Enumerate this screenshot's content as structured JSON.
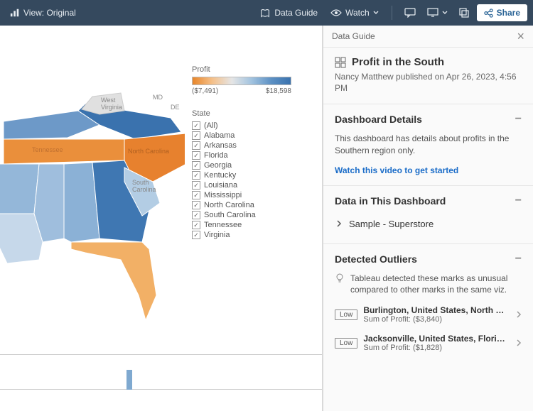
{
  "toolbar": {
    "view_label": "View: Original",
    "data_guide_label": "Data Guide",
    "watch_label": "Watch",
    "share_label": "Share"
  },
  "legend": {
    "title": "Profit",
    "min": "($7,491)",
    "max": "$18,598"
  },
  "state_filter": {
    "title": "State",
    "items": [
      "(All)",
      "Alabama",
      "Arkansas",
      "Florida",
      "Georgia",
      "Kentucky",
      "Louisiana",
      "Mississippi",
      "North Carolina",
      "South Carolina",
      "Tennessee",
      "Virginia"
    ]
  },
  "map_labels": {
    "wv": "West\nVirginia",
    "md": "MD",
    "de": "DE",
    "tn": "Tennessee",
    "nc": "North Carolina",
    "sc": "South\nCarolina"
  },
  "guide": {
    "header": "Data Guide",
    "title": "Profit in the South",
    "meta": "Nancy Matthew published on Apr 26, 2023, 4:56 PM",
    "details": {
      "heading": "Dashboard Details",
      "body": "This dashboard has details about profits in the Southern region only.",
      "link": "Watch this video to get started"
    },
    "data_in": {
      "heading": "Data in This Dashboard",
      "source": "Sample - Superstore"
    },
    "outliers": {
      "heading": "Detected Outliers",
      "intro": "Tableau detected these marks as unusual compared to other marks in the same viz.",
      "items": [
        {
          "tag": "Low",
          "title": "Burlington, United States, North C…",
          "sub": "Sum of Profit: ($3,840)"
        },
        {
          "tag": "Low",
          "title": "Jacksonville, United States, Florid…",
          "sub": "Sum of Profit: ($1,828)"
        }
      ]
    }
  },
  "chart_data": {
    "type": "choropleth-map",
    "title": "Profit in the South",
    "color_scale": {
      "min": -7491,
      "max": 18598,
      "min_label": "($7,491)",
      "max_label": "$18,598"
    },
    "states": [
      {
        "name": "Virginia",
        "profit_approx": 17000,
        "fill": "#3a72ae"
      },
      {
        "name": "Kentucky",
        "profit_approx": 9000,
        "fill": "#6d99c8"
      },
      {
        "name": "Tennessee",
        "profit_approx": -5000,
        "fill": "#ea8f3b"
      },
      {
        "name": "North Carolina",
        "profit_approx": -7491,
        "fill": "#e7812e"
      },
      {
        "name": "South Carolina",
        "profit_approx": 3000,
        "fill": "#b3cde4"
      },
      {
        "name": "Georgia",
        "profit_approx": 15000,
        "fill": "#3f77b2"
      },
      {
        "name": "Alabama",
        "profit_approx": 6000,
        "fill": "#8bb1d6"
      },
      {
        "name": "Mississippi",
        "profit_approx": 4000,
        "fill": "#9fbedd"
      },
      {
        "name": "Arkansas",
        "profit_approx": 5000,
        "fill": "#94b7d9"
      },
      {
        "name": "Louisiana",
        "profit_approx": 2000,
        "fill": "#c6d8ea"
      },
      {
        "name": "Florida",
        "profit_approx": -3000,
        "fill": "#f2b066"
      }
    ]
  }
}
